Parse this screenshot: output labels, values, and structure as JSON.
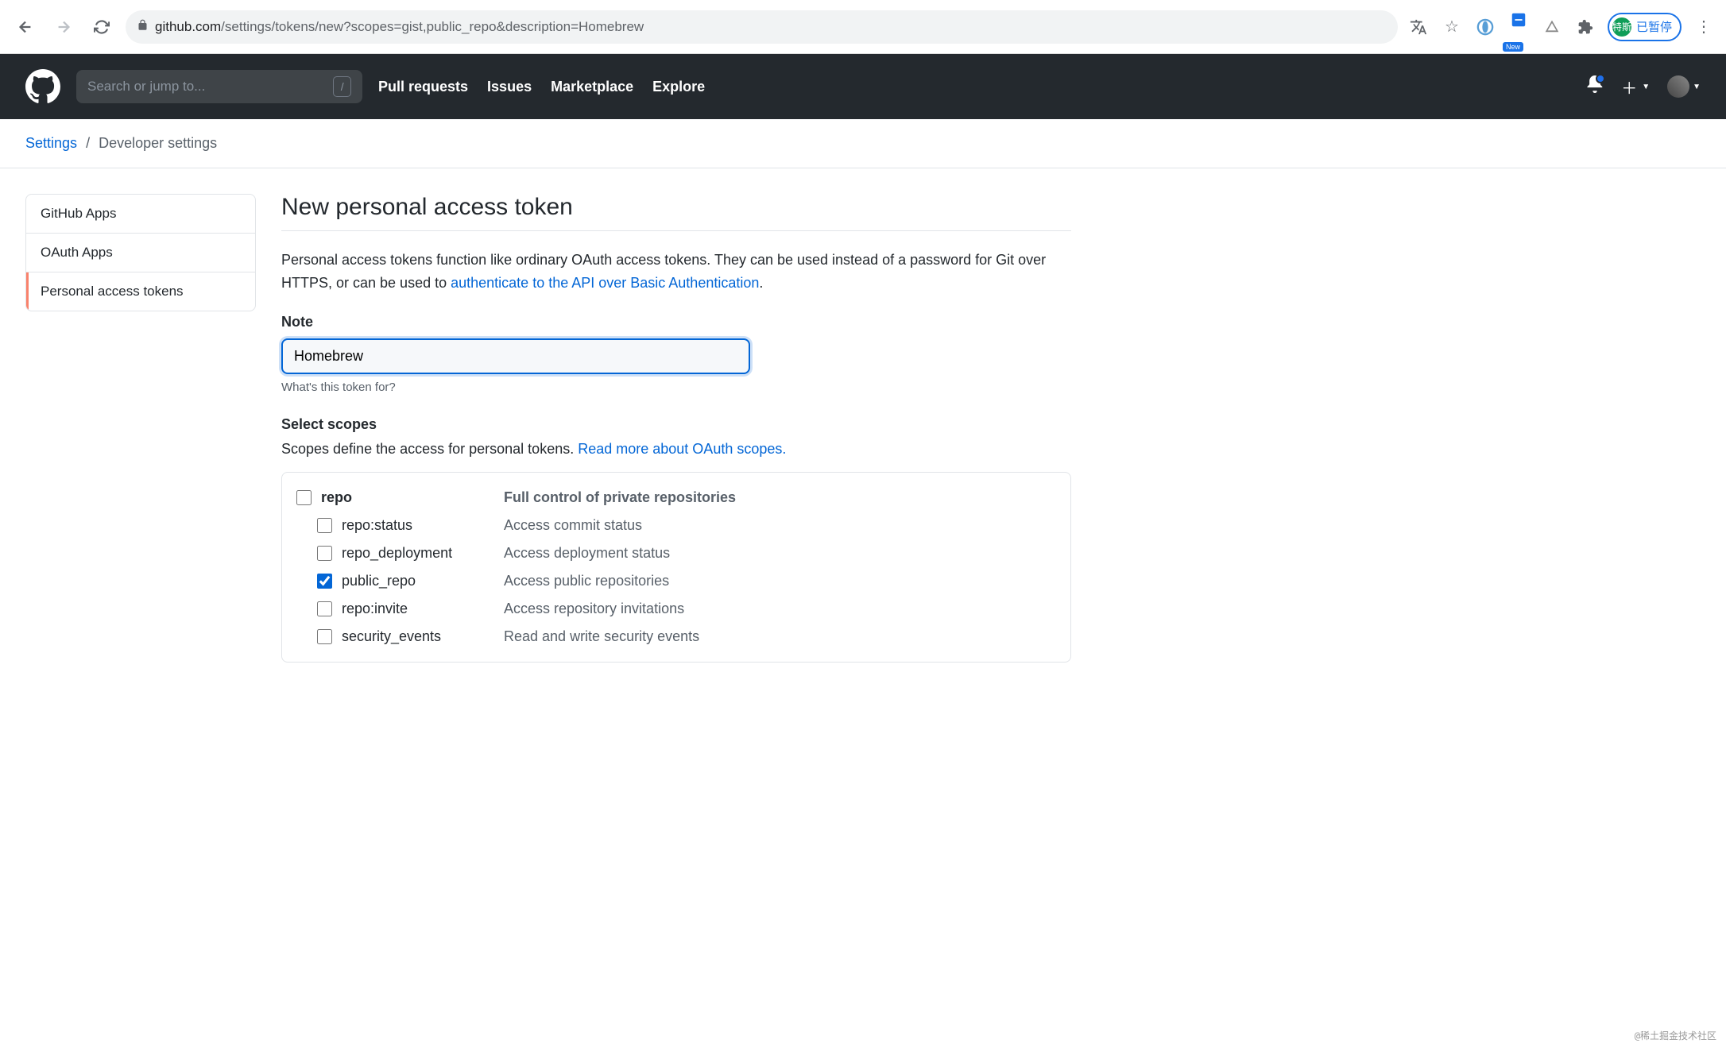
{
  "browser": {
    "url_host": "github.com",
    "url_path": "/settings/tokens/new?scopes=gist,public_repo&description=Homebrew",
    "new_badge": "New",
    "profile_initials": "特斯",
    "profile_status": "已暂停"
  },
  "header": {
    "search_placeholder": "Search or jump to...",
    "nav": [
      "Pull requests",
      "Issues",
      "Marketplace",
      "Explore"
    ]
  },
  "breadcrumb": {
    "link": "Settings",
    "current": "Developer settings"
  },
  "sidebar": {
    "items": [
      {
        "label": "GitHub Apps",
        "active": false
      },
      {
        "label": "OAuth Apps",
        "active": false
      },
      {
        "label": "Personal access tokens",
        "active": true
      }
    ]
  },
  "main": {
    "title": "New personal access token",
    "intro_1": "Personal access tokens function like ordinary OAuth access tokens. They can be used instead of a password for Git over HTTPS, or can be used to ",
    "intro_link": "authenticate to the API over Basic Authentication",
    "intro_2": ".",
    "note_label": "Note",
    "note_value": "Homebrew",
    "note_hint": "What's this token for?",
    "scopes_heading": "Select scopes",
    "scopes_intro": "Scopes define the access for personal tokens. ",
    "scopes_link": "Read more about OAuth scopes.",
    "scopes": [
      {
        "name": "repo",
        "desc": "Full control of private repositories",
        "checked": false,
        "parent": true
      },
      {
        "name": "repo:status",
        "desc": "Access commit status",
        "checked": false,
        "parent": false
      },
      {
        "name": "repo_deployment",
        "desc": "Access deployment status",
        "checked": false,
        "parent": false
      },
      {
        "name": "public_repo",
        "desc": "Access public repositories",
        "checked": true,
        "parent": false
      },
      {
        "name": "repo:invite",
        "desc": "Access repository invitations",
        "checked": false,
        "parent": false
      },
      {
        "name": "security_events",
        "desc": "Read and write security events",
        "checked": false,
        "parent": false
      }
    ]
  },
  "watermark": "@稀土掘金技术社区"
}
